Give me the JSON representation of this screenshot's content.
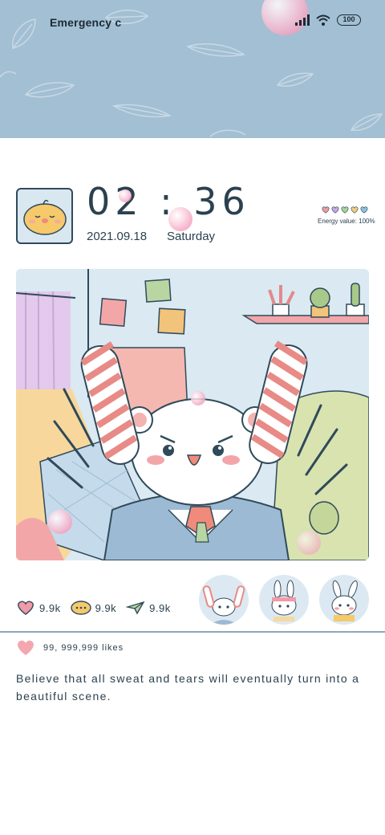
{
  "status_bar": {
    "carrier": "Emergency c",
    "battery": "100",
    "icons": [
      "signal-icon",
      "wifi-icon",
      "battery-icon"
    ]
  },
  "clock": {
    "time": "02 : 36",
    "date": "2021.09.18",
    "weekday": "Saturday"
  },
  "energy": {
    "label": "Energy value:  100%",
    "heart_colors": [
      "#f29aa8",
      "#c7a7e6",
      "#a8d39a",
      "#f2cf7d",
      "#8fc1dc"
    ]
  },
  "stats": [
    {
      "icon": "heart-icon",
      "value": "9.9k"
    },
    {
      "icon": "comment-bubble-icon",
      "value": "9.9k"
    },
    {
      "icon": "paper-plane-icon",
      "value": "9.9k"
    }
  ],
  "likes": {
    "icon": "heart-icon",
    "text": "99, 999,999 likes"
  },
  "quote": "Believe that all sweat and tears will eventually turn into a beautiful scene.",
  "colors": {
    "header": "#a3bfd3",
    "accent_pink": "#f29aa8",
    "text": "#2b4150"
  }
}
